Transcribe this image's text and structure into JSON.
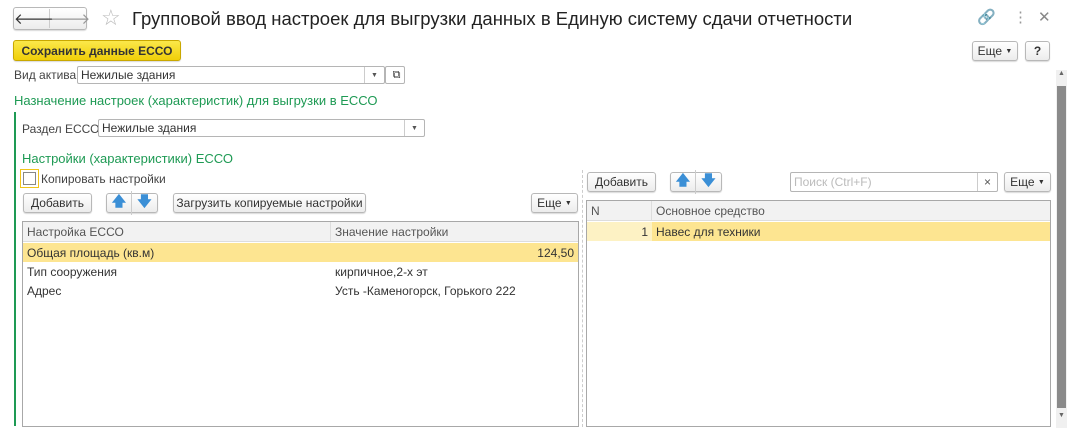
{
  "title": "Групповой ввод настроек для выгрузки  данных в Единую систему сдачи отчетности",
  "toolbar": {
    "save": "Сохранить данные ЕССО",
    "more": "Еще",
    "help": "?"
  },
  "asset": {
    "label": "Вид актива:",
    "value": "Нежилые здания"
  },
  "section_title": "Назначение настроек (характеристик) для выгрузки в ЕССО",
  "razdel": {
    "label": "Раздел ЕССО:",
    "value": "Нежилые здания"
  },
  "settings_title": "Настройки (характеристики) ЕССО",
  "copy_checkbox": {
    "label": "Копировать настройки",
    "checked": false
  },
  "left": {
    "add": "Добавить",
    "load": "Загрузить копируемые настройки",
    "more": "Еще",
    "columns": [
      "Настройка ЕССО",
      "Значение настройки"
    ],
    "rows": [
      [
        "Общая площадь (кв.м)",
        "124,50"
      ],
      [
        "Тип сооружения",
        "кирпичное,2-х эт"
      ],
      [
        "Адрес",
        "Усть -Каменогорск, Горького 222"
      ]
    ]
  },
  "right": {
    "add": "Добавить",
    "search_placeholder": "Поиск (Ctrl+F)",
    "clear": "×",
    "more": "Еще",
    "columns": [
      "N",
      "Основное средство"
    ],
    "rows": [
      [
        "1",
        "Навес для техники"
      ]
    ]
  },
  "colors": {
    "accent_yellow": "#f5d80f",
    "green": "#1e9a54",
    "selected_row": "#fde591"
  }
}
